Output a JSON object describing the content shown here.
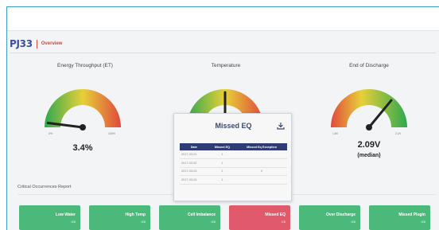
{
  "header": {
    "brand": "PJ33",
    "subtitle": "Overview"
  },
  "gauges": [
    {
      "title": "Energy Throughput (ET)",
      "min_label": "0%",
      "max_label": "100%",
      "value_text": "3.4%",
      "sub_text": "",
      "needle_fraction": 0.04
    },
    {
      "title": "Temperature",
      "min_label": "",
      "max_label": "",
      "value_text": "",
      "sub_text": "",
      "needle_fraction": 0.5
    },
    {
      "title": "End of Discharge",
      "min_label": "1.8V",
      "max_label": "2.2V",
      "value_text": "2.09V",
      "sub_text": "(median)",
      "needle_fraction": 0.72
    }
  ],
  "modal": {
    "title": "Missed EQ",
    "icon": "download-icon",
    "columns": [
      "Date",
      "Missed EQ",
      "Missed Eq Exception"
    ],
    "rows": [
      [
        "2017-03-01",
        "1",
        ""
      ],
      [
        "2017-03-02",
        "1",
        ""
      ],
      [
        "2017-03-03",
        "1",
        "0"
      ],
      [
        "2017-03-04",
        "1",
        ""
      ]
    ]
  },
  "report": {
    "title": "Critical Occurrences Report"
  },
  "tiles": [
    {
      "label": "Low Water",
      "count": "0/6",
      "color": "#4bb97a",
      "icon": ""
    },
    {
      "label": "High Temp",
      "count": "0/6",
      "color": "#4bb97a",
      "icon": ""
    },
    {
      "label": "Cell Imbalance",
      "count": "0/6",
      "color": "#4bb97a",
      "icon": ""
    },
    {
      "label": "Missed EQ",
      "count": "1/6",
      "color": "#e05a6b",
      "icon": ""
    },
    {
      "label": "Over Discharge",
      "count": "0/6",
      "color": "#4bb97a",
      "icon": ""
    },
    {
      "label": "Missed Plugin",
      "count": "0/6",
      "color": "#4bb97a",
      "icon": ""
    }
  ],
  "colors": {
    "brand": "#3b4fa3",
    "accent_red": "#d0463c",
    "ok_green": "#4bb97a",
    "alert_red": "#e05a6b",
    "table_header": "#2e3b74"
  }
}
